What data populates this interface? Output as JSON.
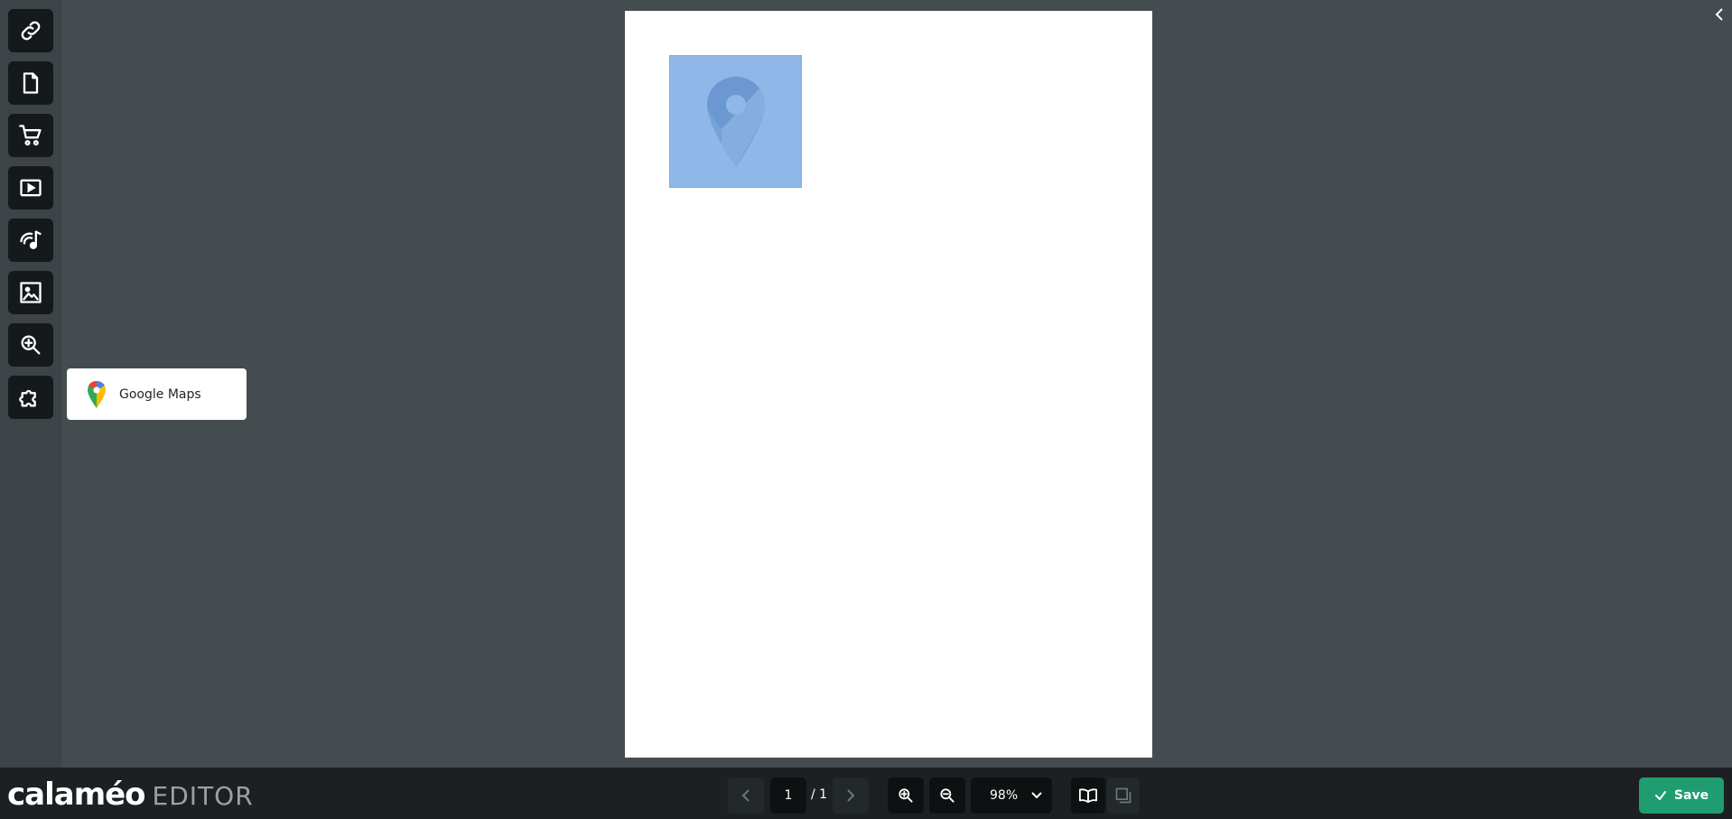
{
  "sidebar": {
    "tools": [
      {
        "name": "link-icon"
      },
      {
        "name": "page-icon"
      },
      {
        "name": "cart-icon"
      },
      {
        "name": "video-icon"
      },
      {
        "name": "audio-icon"
      },
      {
        "name": "image-icon"
      },
      {
        "name": "zoom-icon"
      },
      {
        "name": "plugin-icon"
      }
    ]
  },
  "plugins": {
    "items": [
      {
        "label": "Google Maps",
        "icon": "google-maps-icon"
      }
    ]
  },
  "canvas": {
    "widget_icon": "map-pin-icon"
  },
  "brand": {
    "logo": "calaméo",
    "suffix": "EDITOR"
  },
  "pager": {
    "current": "1",
    "total": "/ 1"
  },
  "zoom": {
    "level": "98%"
  },
  "actions": {
    "save_label": "Save"
  },
  "colors": {
    "accent_green": "#1f9d70",
    "background": "#454c50",
    "toolbar": "#1c2022",
    "map_widget": "#8fb7e8"
  }
}
